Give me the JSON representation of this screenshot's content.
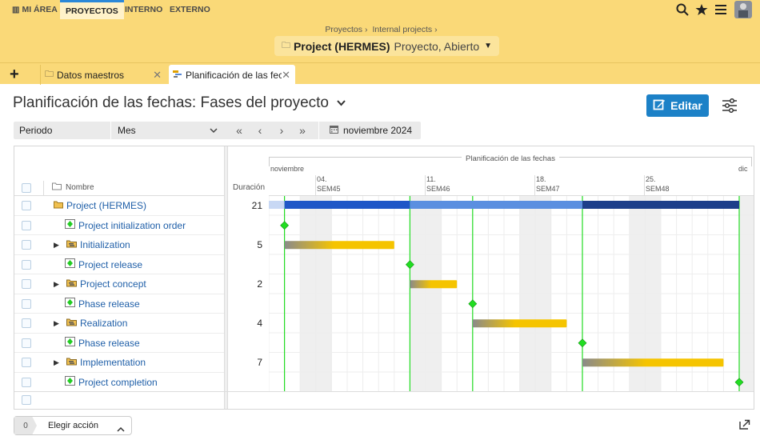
{
  "nav": {
    "items": [
      {
        "label": "MI ÁREA"
      },
      {
        "label": "PROYECTOS"
      },
      {
        "label": "INTERNO"
      },
      {
        "label": "EXTERNO"
      }
    ]
  },
  "header": {
    "breadcrumb": [
      "Proyectos",
      "Internal projects"
    ],
    "project_name": "Project (HERMES)",
    "project_status": "Proyecto, Abierto"
  },
  "tabs": [
    {
      "label": "Datos maestros"
    },
    {
      "label": "Planificación de las fechas"
    }
  ],
  "page": {
    "title": "Planificación de las fechas: Fases del proyecto",
    "edit_label": "Editar"
  },
  "toolbar": {
    "period_label": "Periodo",
    "period_value": "Mes",
    "current_month": "noviembre 2024"
  },
  "grid": {
    "col_name": "Nombre",
    "col_duration": "Duración",
    "gantt_title": "Planificación de las fechas",
    "month_left": "noviembre",
    "month_right": "dic",
    "weeks": [
      {
        "day": "04.",
        "week": "SEM45"
      },
      {
        "day": "11.",
        "week": "SEM46"
      },
      {
        "day": "18.",
        "week": "SEM47"
      },
      {
        "day": "25.",
        "week": "SEM48"
      }
    ],
    "rows": [
      {
        "name": "Project (HERMES)",
        "duration": "21",
        "type": "project"
      },
      {
        "name": "Project initialization order",
        "duration": "",
        "type": "milestone"
      },
      {
        "name": "Initialization",
        "duration": "5",
        "type": "phase"
      },
      {
        "name": "Project release",
        "duration": "",
        "type": "milestone"
      },
      {
        "name": "Project concept",
        "duration": "2",
        "type": "phase"
      },
      {
        "name": "Phase release",
        "duration": "",
        "type": "milestone"
      },
      {
        "name": "Realization",
        "duration": "4",
        "type": "phase"
      },
      {
        "name": "Phase release",
        "duration": "",
        "type": "milestone"
      },
      {
        "name": "Implementation",
        "duration": "7",
        "type": "phase"
      },
      {
        "name": "Project completion",
        "duration": "",
        "type": "milestone"
      }
    ]
  },
  "footer": {
    "selected_count": "0",
    "action_label": "Elegir acción"
  },
  "colors": {
    "header_bg": "#fad978",
    "accent": "#1c81c7",
    "phase_bar": "#f5c400",
    "milestone": "#22dd22",
    "project_bar": "#1f57c7"
  }
}
